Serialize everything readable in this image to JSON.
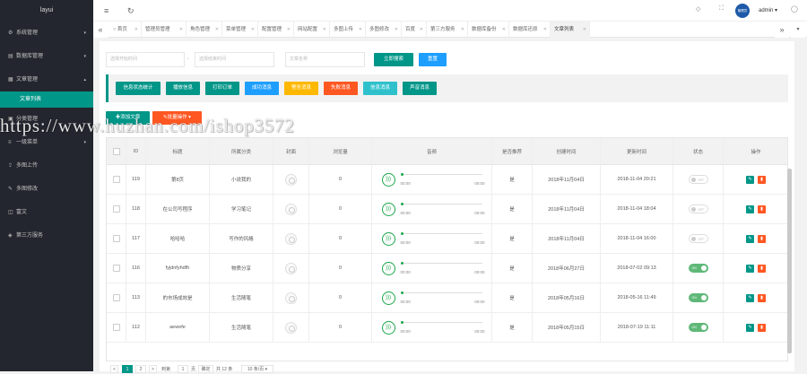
{
  "sidebar": {
    "logo": "layui",
    "items": [
      {
        "icon": "⚙",
        "label": "系统管理",
        "arrow": "▾"
      },
      {
        "icon": "▤",
        "label": "数据库管理",
        "arrow": "▾"
      },
      {
        "icon": "▦",
        "label": "文章管理",
        "arrow": "▴"
      }
    ],
    "active_sub": "文章列表",
    "items2": [
      {
        "icon": "▣",
        "label": "分类管理",
        "arrow": ""
      },
      {
        "icon": "≡",
        "label": "一级菜单",
        "arrow": "▾"
      },
      {
        "icon": "⇪",
        "label": "多图上传",
        "arrow": ""
      },
      {
        "icon": "✎",
        "label": "多图修改",
        "arrow": ""
      },
      {
        "icon": "◫",
        "label": "富文",
        "arrow": ""
      },
      {
        "icon": "◈",
        "label": "第三方服务",
        "arrow": ""
      }
    ]
  },
  "topbar": {
    "menu_icon": "≡",
    "refresh_icon": "↻",
    "user": "admin",
    "avatar_text": "管理员",
    "icons": [
      "◇",
      "⛶"
    ],
    "msg_icon": "◯"
  },
  "tabs": [
    "首页",
    "管理员管理",
    "角色管理",
    "菜单管理",
    "配置管理",
    "网站配置",
    "多图上传",
    "多图修改",
    "百度",
    "第三方服务",
    "数据库备份",
    "数据库还原",
    "文章列表"
  ],
  "filters": {
    "p1": "选择开始时间",
    "p2": "选择结束时间",
    "p3": "文章名称",
    "sep": "-",
    "search": "立即搜索",
    "reset": "重置"
  },
  "stat_buttons": [
    {
      "label": "信息状态统计",
      "color": "#009688"
    },
    {
      "label": "播放信息",
      "color": "#009688"
    },
    {
      "label": "打印订单",
      "color": "#009688"
    },
    {
      "label": "成功消息",
      "color": "#1e9fff"
    },
    {
      "label": "警告消息",
      "color": "#ffb800"
    },
    {
      "label": "失败消息",
      "color": "#ff5722"
    },
    {
      "label": "信息消息",
      "color": "#2ec1cc"
    },
    {
      "label": "声音消息",
      "color": "#009688"
    }
  ],
  "actions": {
    "add": "✚添加文章",
    "batch": "✎批量操作 ▾"
  },
  "watermark": "https://www.huzhan.com/ishop3572",
  "table": {
    "headers": [
      "",
      "ID",
      "标题",
      "所属分类",
      "封面",
      "浏览量",
      "音频",
      "是否推荐",
      "创建时间",
      "更新时间",
      "状态",
      "操作"
    ],
    "rows": [
      {
        "id": "119",
        "title": "第8页",
        "cat": "小说我的",
        "views": "0",
        "t0": "00:00",
        "t1": "00:00",
        "rec": "是",
        "created": "2018年11月04日",
        "updated": "2018-11-04 20:21",
        "status": "OFF"
      },
      {
        "id": "118",
        "title": "在公司写程序",
        "cat": "学习笔记",
        "views": "0",
        "t0": "00:00",
        "t1": "00:00",
        "rec": "是",
        "created": "2018年11月04日",
        "updated": "2018-11-04 18:04",
        "status": "OFF"
      },
      {
        "id": "117",
        "title": "哈哈哈",
        "cat": "写作的风格",
        "views": "0",
        "t0": "00:00",
        "t1": "00:00",
        "rec": "是",
        "created": "2018年11月04日",
        "updated": "2018-11-04 16:00",
        "status": "OFF"
      },
      {
        "id": "116",
        "title": "fyjdnfyhdfh",
        "cat": "物质分享",
        "views": "0",
        "t0": "00:00",
        "t1": "00:00",
        "rec": "是",
        "created": "2018年06月27日",
        "updated": "2018-07-02 09:13",
        "status": "ON"
      },
      {
        "id": "113",
        "title": "的市场成效是",
        "cat": "生活随笔",
        "views": "0",
        "t0": "00:00",
        "t1": "00:00",
        "rec": "是",
        "created": "2018年05月16日",
        "updated": "2018-05-16 11:49",
        "status": "ON"
      },
      {
        "id": "112",
        "title": "aewefe",
        "cat": "生活随笔",
        "views": "0",
        "t0": "00:00",
        "t1": "00:00",
        "rec": "是",
        "created": "2018年05月15日",
        "updated": "2018-07-19 11:11",
        "status": "ON"
      }
    ]
  },
  "pager": {
    "prev": "<",
    "p1": "1",
    "p2": "2",
    "next": ">",
    "goto": "到第",
    "input": "1",
    "page": "页",
    "confirm": "确定",
    "total": "共 12 条",
    "size": "10 条/页 ▾"
  }
}
